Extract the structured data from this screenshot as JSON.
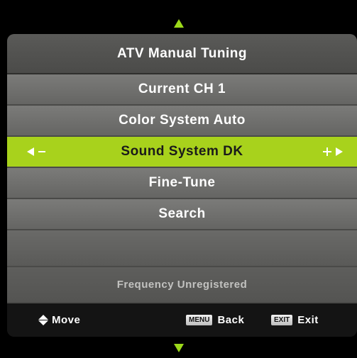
{
  "menu": {
    "title": "ATV Manual Tuning",
    "items": [
      {
        "label": "Current CH 1"
      },
      {
        "label": "Color System Auto"
      },
      {
        "label": "Sound System DK"
      },
      {
        "label": "Fine-Tune"
      },
      {
        "label": "Search"
      },
      {
        "label": ""
      }
    ],
    "selected_index": 2,
    "status": "Frequency Unregistered"
  },
  "footer": {
    "move_label": "Move",
    "menu_key": "MENU",
    "back_label": "Back",
    "exit_key": "EXIT",
    "exit_label": "Exit"
  },
  "icons": {
    "scroll_up": "triangle-up-icon",
    "scroll_down": "triangle-down-icon",
    "decrease": "left-arrow-minus-icon",
    "increase": "plus-right-arrow-icon",
    "move": "up-down-icon"
  },
  "colors": {
    "accent": "#a8d21c",
    "arrow": "#9cd91a",
    "background": "#000000"
  }
}
